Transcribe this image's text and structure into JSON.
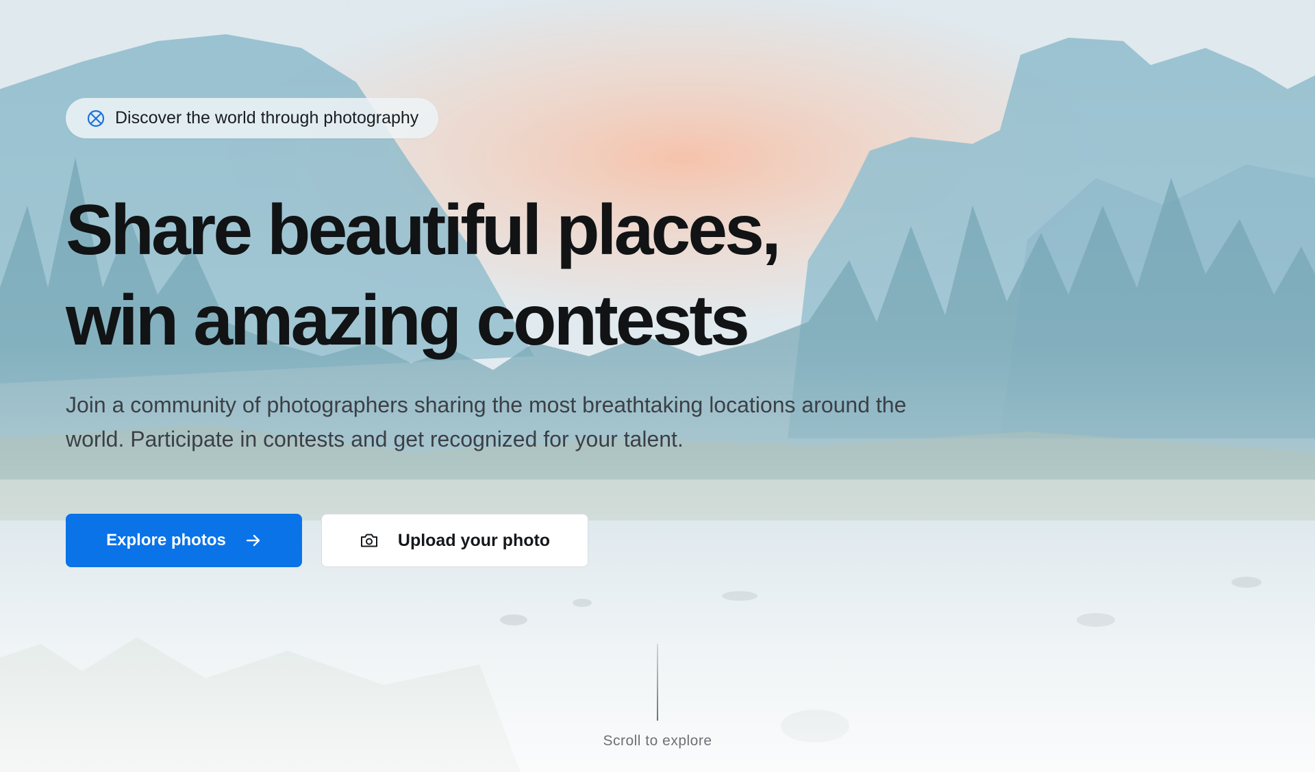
{
  "hero": {
    "badge": {
      "icon": "compass-icon",
      "text": "Discover the world through photography"
    },
    "headline": {
      "line1": "Share beautiful places,",
      "line2": "win amazing contests"
    },
    "subtitle": "Join a community of photographers sharing the most breathtaking locations around the world. Participate in contests and get recognized for your talent.",
    "primary_button": {
      "label": "Explore photos",
      "icon": "arrow-right-icon"
    },
    "secondary_button": {
      "label": "Upload your photo",
      "icon": "camera-icon"
    },
    "scroll_hint": "Scroll to explore"
  },
  "colors": {
    "accent": "#0a73e8",
    "headline": "#111315",
    "body_text": "#3b4046",
    "muted": "#6b7177"
  }
}
